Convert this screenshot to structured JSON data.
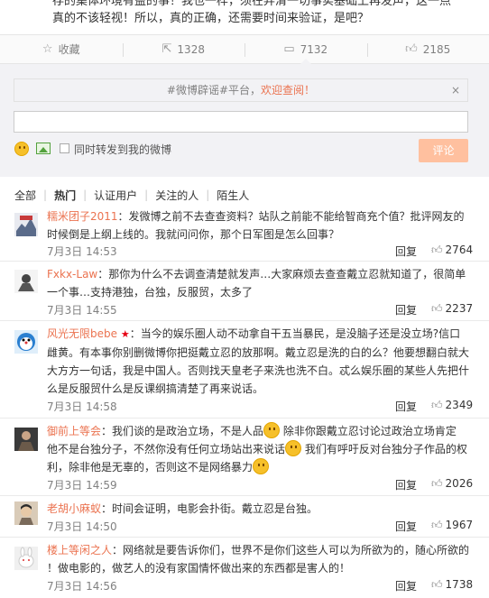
{
  "post": {
    "line1": "存的集体环境有益的事！我也一样，须在弄清一切事实基础上再发声，这一点",
    "line2": "真的不该轻视！所以，真的正确，还需要时间来验证，是吧？"
  },
  "actions": [
    {
      "icon": "star-icon",
      "label": "收藏"
    },
    {
      "icon": "share-icon",
      "label": "1328"
    },
    {
      "icon": "comment-icon",
      "label": "7132"
    },
    {
      "icon": "thumbs-up-icon",
      "label": "2185"
    }
  ],
  "composer": {
    "notice_prefix": "#微博辟谣#平台，",
    "notice_highlight": "欢迎查阅！",
    "close": "×",
    "input_value": "",
    "checkbox_label": "同时转发到我的微博",
    "submit_label": "评论"
  },
  "filters": [
    "全部",
    "热门",
    "认证用户",
    "关注的人",
    "陌生人"
  ],
  "comments": [
    {
      "user": "糯米团子2011",
      "text_lines": [
        "：发微博之前不去查查资料？站队之前能不能给智商充个值？批评网友的",
        "时候倒是上纲上线的。我就问问你，那个日军图是怎么回事？"
      ],
      "time": "7月3日 14:53",
      "reply": "回复",
      "likes": "2764"
    },
    {
      "user": "Fxkx-Law",
      "text_lines": [
        "：那你为什么不去调查清楚就发声…大家麻烦去查查戴立忍就知道了，很简单",
        "一个事…支持港独，台独，反服贸，太多了"
      ],
      "time": "7月3日 14:55",
      "reply": "回复",
      "likes": "2237"
    },
    {
      "user": "风光无限bebe",
      "text_lines": [
        "：当今的娱乐圈人动不动拿自干五当暴民，是没脑子还是没立场?信口",
        "雌黄。有本事你别删微博你把挺戴立忍的放那啊。戴立忍是洗的白的么？他要想翻白就大",
        "大方方一句话，我是中国人。否则找天皇老子来洗也洗不白。忒么娱乐圈的某些人先把什",
        "么是反服贸什么是反课纲搞清楚了再来说话。"
      ],
      "time": "7月3日 14:58",
      "reply": "回复",
      "likes": "2349"
    },
    {
      "user": "御前上等会",
      "text_lines": [
        "：我们谈的是政治立场，不是人品",
        "除非你跟戴立忍讨论过政治立场肯定",
        "他不是台独分子，不然你没有任何立场站出来说话",
        "我们有呼吁反对台独分子作品的权",
        "利，除非他是无辜的，否则这不是网络暴力"
      ],
      "time": "7月3日 14:59",
      "reply": "回复",
      "likes": "2026"
    },
    {
      "user": "老胡小麻蚁",
      "text_lines": [
        "：时间会证明，电影会扑街。戴立忍是台独。"
      ],
      "time": "7月3日 14:50",
      "reply": "回复",
      "likes": "1967"
    },
    {
      "user": "楼上等闲之人",
      "text_lines": [
        "：网络就是要告诉你们，世界不是你们这些人可以为所欲为的，随心所欲的",
        "！做电影的，做艺人的没有家国情怀做出来的东西都是害人的！"
      ],
      "time": "7月3日 14:56",
      "reply": "回复",
      "likes": "1738"
    }
  ],
  "colors": {
    "accent": "#eb7350",
    "submit_bg": "#ffc09f",
    "composer_bg": "#f2f2f5"
  }
}
